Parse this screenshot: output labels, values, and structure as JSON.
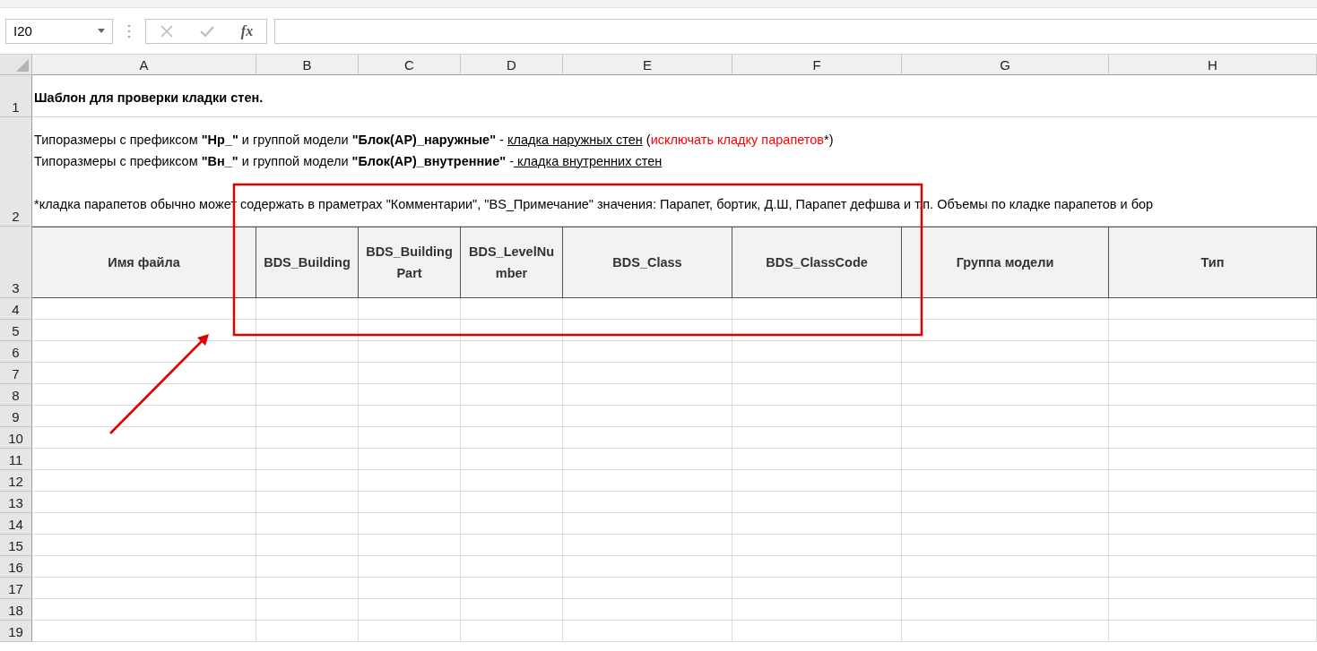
{
  "name_box": {
    "value": "I20"
  },
  "formula_bar": {
    "function_label": "fx"
  },
  "columns": [
    "A",
    "B",
    "C",
    "D",
    "E",
    "F",
    "G",
    "H"
  ],
  "rows": [
    "1",
    "2",
    "3",
    "4",
    "5",
    "6",
    "7",
    "8",
    "9",
    "10",
    "11",
    "12",
    "13",
    "14",
    "15",
    "16",
    "17",
    "18",
    "19"
  ],
  "title_cell": "Шаблон для проверки кладки стен.",
  "note_lines": [
    [
      {
        "kind": "plain",
        "text": "Типоразмеры с префиксом "
      },
      {
        "kind": "bold",
        "text": "\"Нр_\""
      },
      {
        "kind": "plain",
        "text": " и группой модели "
      },
      {
        "kind": "bold",
        "text": "\"Блок(АР)_наружные\""
      },
      {
        "kind": "plain",
        "text": " - "
      },
      {
        "kind": "underline",
        "text": "кладка наружных стен"
      },
      {
        "kind": "plain",
        "text": " ("
      },
      {
        "kind": "red",
        "text": "исключать кладку парапетов"
      },
      {
        "kind": "plain",
        "text": "*)"
      }
    ],
    [
      {
        "kind": "plain",
        "text": "Типоразмеры с префиксом "
      },
      {
        "kind": "bold",
        "text": "\"Вн_\""
      },
      {
        "kind": "plain",
        "text": " и группой модели "
      },
      {
        "kind": "bold",
        "text": "\"Блок(АР)_внутренние\""
      },
      {
        "kind": "plain",
        "text": " -"
      },
      {
        "kind": "underline",
        "text": " кладка внутренних стен "
      }
    ],
    [
      {
        "kind": "plain",
        "text": "*кладка парапетов обычно может содержать в праметрах \"Комментарии\", \"BS_Примечание\" значения: Парапет, бортик, Д.Ш, Парапет дефшва и т.п. Объемы по кладке парапетов и бор"
      }
    ]
  ],
  "header_cells": [
    "Имя файла",
    "BDS_Building",
    "BDS_Building Part",
    "BDS_LevelNumber",
    "BDS_Class",
    "BDS_ClassCode",
    "Группа модели",
    "Тип"
  ]
}
